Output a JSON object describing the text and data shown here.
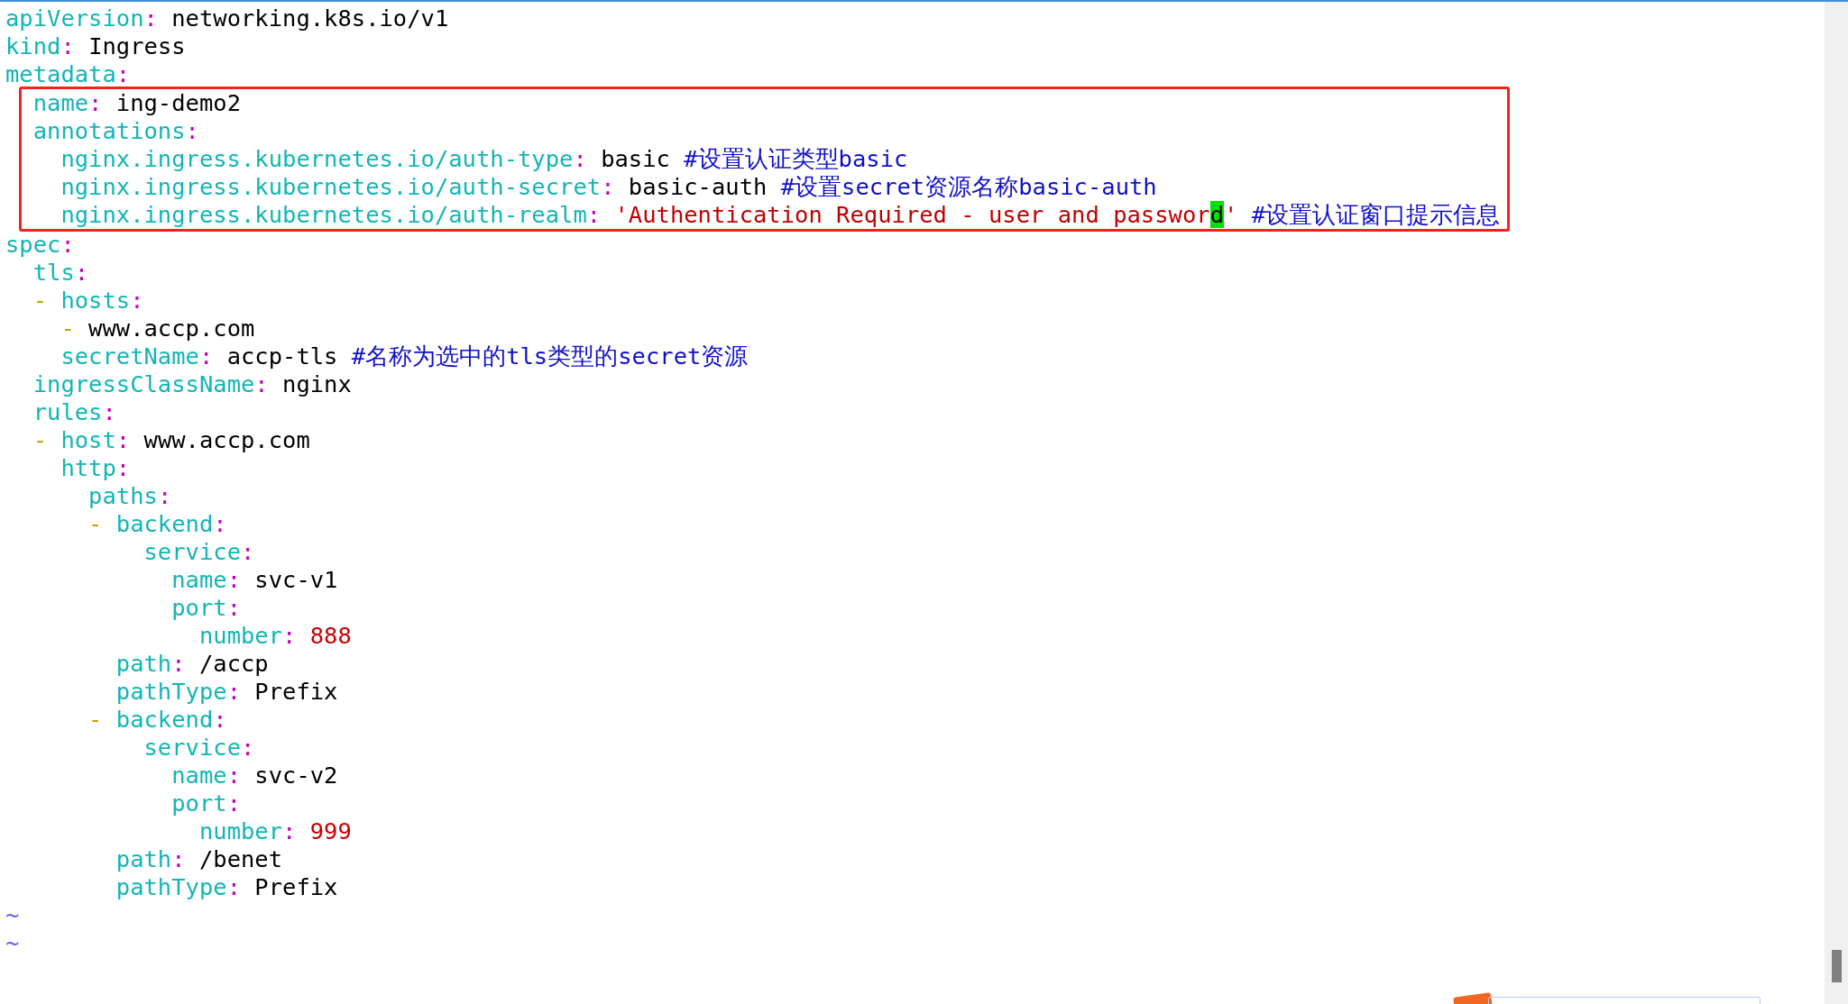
{
  "editor": {
    "lines": [
      {
        "key": "apiVersion:",
        "value": "networking.k8s.io/v1",
        "kind": "plain"
      },
      {
        "key": "kind:",
        "value": "Ingress",
        "kind": "plain"
      },
      {
        "key": "metadata:",
        "boxed": true,
        "children": [
          {
            "key": "name:",
            "value": "ing-demo2",
            "kind": "plain"
          },
          {
            "key": "annotations:",
            "children": [
              {
                "key": "nginx.ingress.kubernetes.io/auth-type:",
                "value": "basic",
                "kind": "plain",
                "comment": "#设置认证类型basic"
              },
              {
                "key": "nginx.ingress.kubernetes.io/auth-secret:",
                "value": "basic-auth",
                "kind": "plain",
                "comment": "#设置secret资源名称basic-auth"
              },
              {
                "key": "nginx.ingress.kubernetes.io/auth-realm:",
                "kind": "string",
                "value_parts": [
                  {
                    "text": "'Authentication Required - user and passwor",
                    "cursor": false
                  },
                  {
                    "text": "d",
                    "cursor": true
                  },
                  {
                    "text": "'",
                    "cursor": false
                  }
                ],
                "comment": "#设置认证窗口提示信息"
              }
            ]
          }
        ]
      },
      {
        "key": "spec:",
        "children": [
          {
            "key": "tls:",
            "children": [
              {
                "key": "hosts:",
                "dash": "-",
                "children": [
                  {
                    "value": "www.accp.com",
                    "kind": "plain",
                    "dash": "-"
                  }
                ]
              },
              {
                "key": "secretName:",
                "value": "accp-tls",
                "kind": "plain",
                "comment": "#名称为选中的tls类型的secret资源"
              }
            ]
          },
          {
            "key": "ingressClassName:",
            "value": "nginx",
            "kind": "plain"
          },
          {
            "key": "rules:",
            "children": [
              {
                "key": "host:",
                "value": "www.accp.com",
                "kind": "plain",
                "dash": "-"
              },
              {
                "key": "http:",
                "children": [
                  {
                    "key": "paths:",
                    "children": [
                      {
                        "key": "backend:",
                        "dash": "-",
                        "children": [
                          {
                            "key": "service:",
                            "children": [
                              {
                                "key": "name:",
                                "value": "svc-v1",
                                "kind": "plain"
                              },
                              {
                                "key": "port:",
                                "children": [
                                  {
                                    "key": "number:",
                                    "value": "888",
                                    "kind": "number"
                                  }
                                ]
                              }
                            ]
                          }
                        ]
                      },
                      {
                        "key": "path:",
                        "value": "/accp",
                        "kind": "plain"
                      },
                      {
                        "key": "pathType:",
                        "value": "Prefix",
                        "kind": "plain"
                      },
                      {
                        "key": "backend:",
                        "dash": "-",
                        "children": [
                          {
                            "key": "service:",
                            "children": [
                              {
                                "key": "name:",
                                "value": "svc-v2",
                                "kind": "plain"
                              },
                              {
                                "key": "port:",
                                "children": [
                                  {
                                    "key": "number:",
                                    "value": "999",
                                    "kind": "number"
                                  }
                                ]
                              }
                            ]
                          }
                        ]
                      },
                      {
                        "key": "path:",
                        "value": "/benet",
                        "kind": "plain"
                      },
                      {
                        "key": "pathType:",
                        "value": "Prefix",
                        "kind": "plain"
                      }
                    ]
                  }
                ]
              }
            ]
          }
        ]
      }
    ],
    "tildes": [
      "~",
      "~"
    ]
  }
}
